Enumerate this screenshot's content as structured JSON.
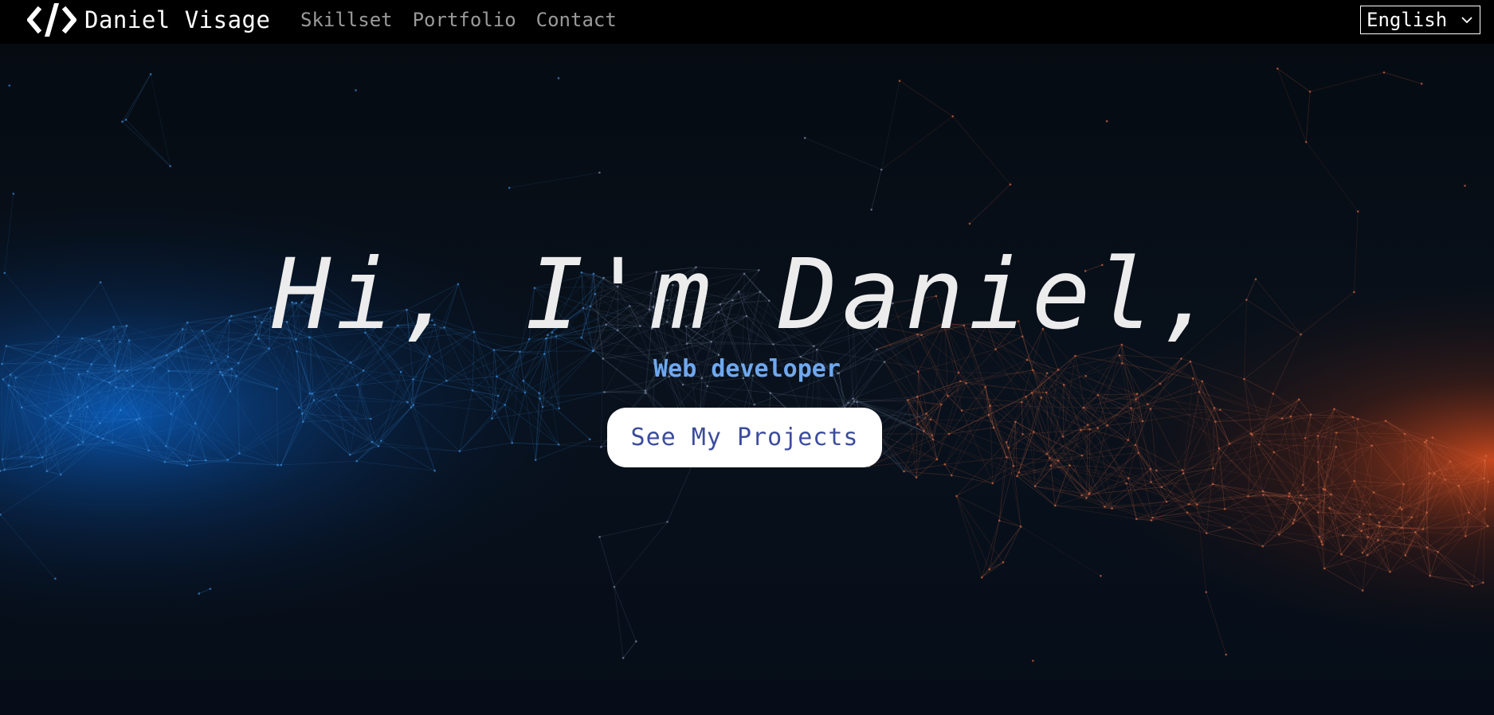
{
  "navbar": {
    "brand_name": "Daniel Visage",
    "brand_icon": "code-slash-icon",
    "links": [
      {
        "label": "Skillset"
      },
      {
        "label": "Portfolio"
      },
      {
        "label": "Contact"
      }
    ],
    "language": {
      "selected": "English"
    }
  },
  "hero": {
    "title": "Hi, I'm Daniel,",
    "subtitle": "Web developer",
    "cta_label": "See My Projects"
  },
  "colors": {
    "navbar_bg": "#000000",
    "page_bg": "#050a12",
    "accent_blue": "#6fa8f0",
    "button_text": "#3c4c9c",
    "glow_left": "#0a6ad8",
    "glow_right": "#e04a1a"
  }
}
